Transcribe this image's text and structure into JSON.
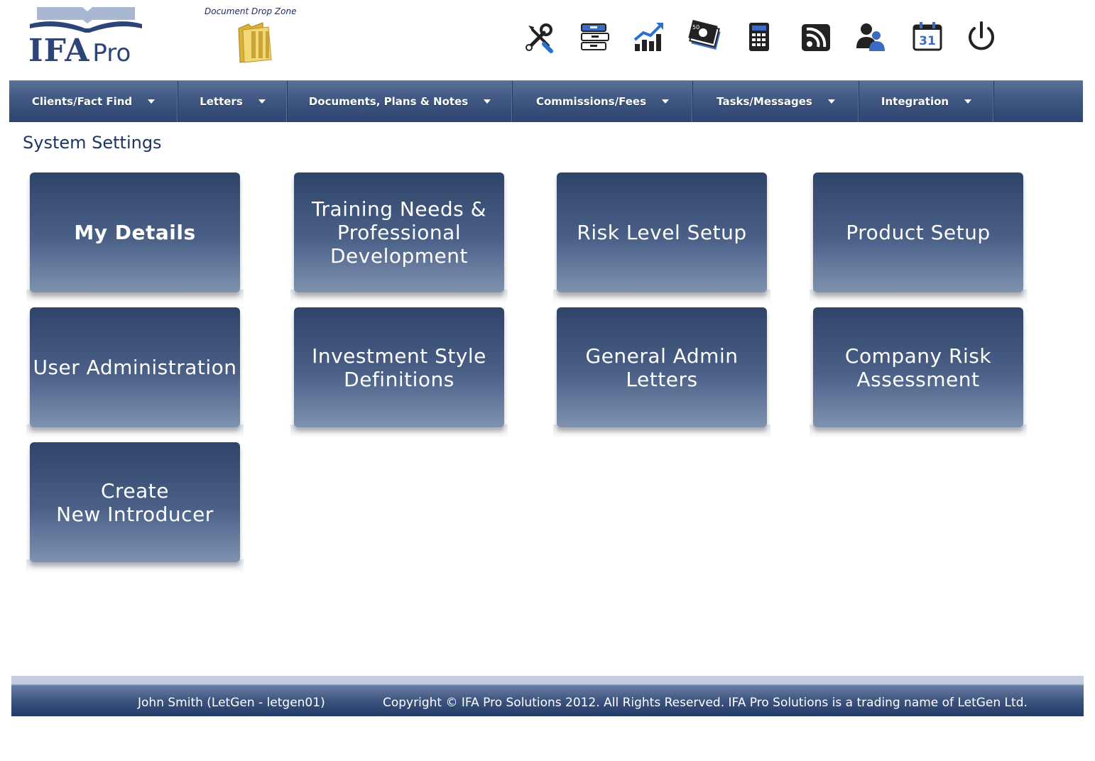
{
  "brand": {
    "name": "IFA",
    "suffix": "Pro"
  },
  "dropzone": {
    "label": "Document Drop Zone"
  },
  "toolbar": [
    {
      "icon": "tools-icon"
    },
    {
      "icon": "filing-cabinet-icon"
    },
    {
      "icon": "growth-chart-icon"
    },
    {
      "icon": "money-notes-icon"
    },
    {
      "icon": "calculator-icon"
    },
    {
      "icon": "rss-feed-icon"
    },
    {
      "icon": "users-icon"
    },
    {
      "icon": "calendar-icon"
    },
    {
      "icon": "power-icon"
    }
  ],
  "calendar_day": "31",
  "money_note": "50",
  "nav": [
    {
      "label": "Clients/Fact Find"
    },
    {
      "label": "Letters"
    },
    {
      "label": "Documents, Plans & Notes"
    },
    {
      "label": "Commissions/Fees"
    },
    {
      "label": "Tasks/Messages"
    },
    {
      "label": "Integration"
    }
  ],
  "page_title": "System Settings",
  "tiles": [
    {
      "label": "My Details"
    },
    {
      "label": "Training Needs &\nProfessional\nDevelopment"
    },
    {
      "label": "Risk Level Setup"
    },
    {
      "label": "Product Setup"
    },
    {
      "label": "User Administration"
    },
    {
      "label": "Investment Style\nDefinitions"
    },
    {
      "label": "General Admin\nLetters"
    },
    {
      "label": "Company Risk\nAssessment"
    },
    {
      "label": "Create\nNew Introducer"
    }
  ],
  "footer": {
    "user": "John Smith (LetGen - letgen01)",
    "copyright": "Copyright © IFA Pro Solutions 2012. All Rights Reserved. IFA Pro Solutions is a trading name of LetGen Ltd."
  }
}
